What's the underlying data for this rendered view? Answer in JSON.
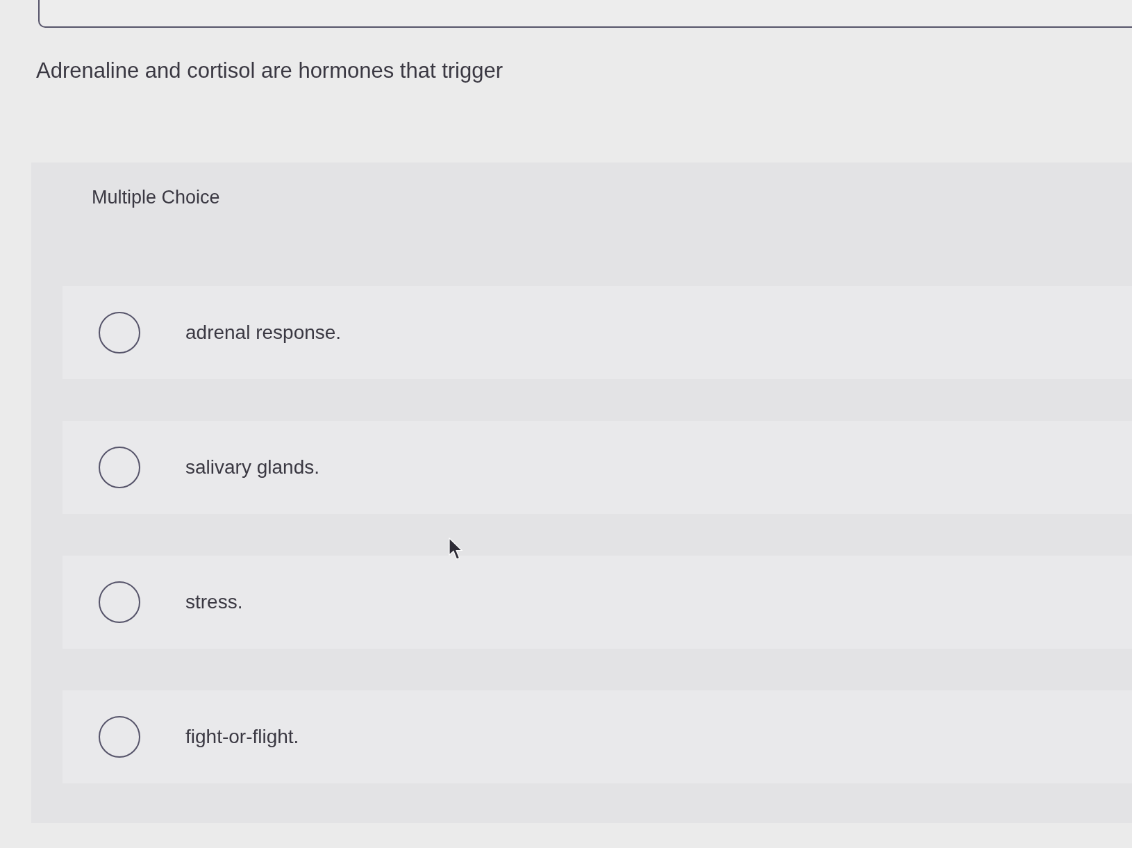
{
  "answer_box": {
    "kind": "empty"
  },
  "question": "Adrenaline and cortisol are hormones that trigger",
  "multiple_choice": {
    "heading": "Multiple Choice",
    "options": [
      {
        "label": "adrenal response.",
        "selected": false
      },
      {
        "label": "salivary glands.",
        "selected": false
      },
      {
        "label": "stress.",
        "selected": false
      },
      {
        "label": "fight-or-flight.",
        "selected": false
      }
    ]
  }
}
